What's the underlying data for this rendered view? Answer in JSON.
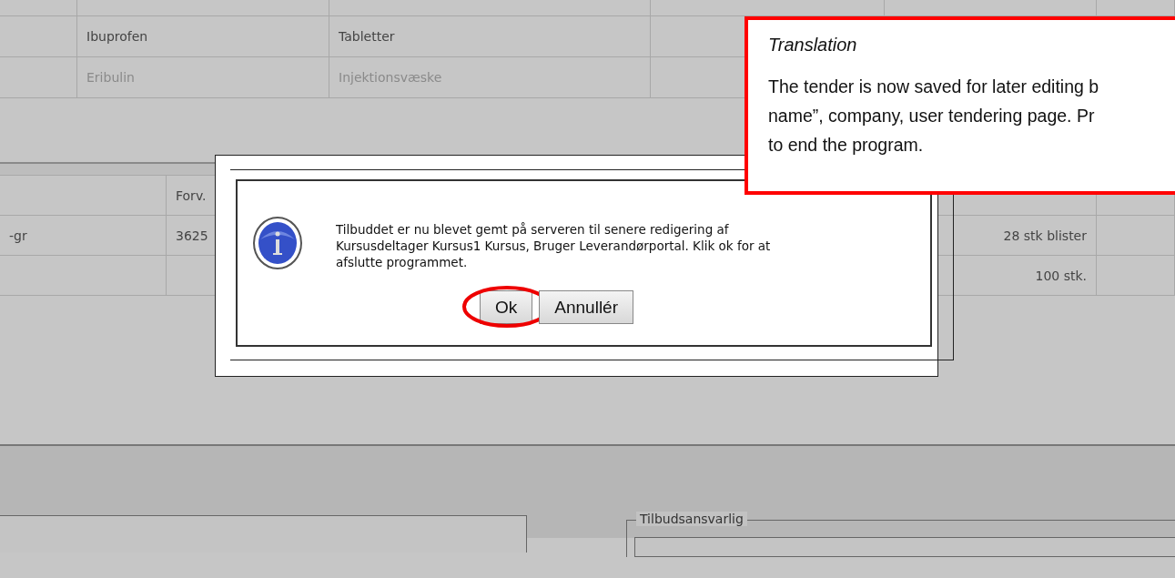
{
  "table_top": {
    "rows": [
      {
        "column_2": "Ibuprofen",
        "column_3": "Tabletter",
        "disabled": false
      },
      {
        "column_2": "Eribulin",
        "column_3": "Injektionsvæske",
        "disabled": true
      }
    ]
  },
  "table_bottom": {
    "header": {
      "column_2": "Forv."
    },
    "rows": [
      {
        "column_1": "-gr",
        "column_2": "3625",
        "column_3": "28 stk blister"
      },
      {
        "column_3": "100 stk."
      }
    ]
  },
  "fieldset": {
    "legend": "Tilbudsansvarlig"
  },
  "dialog": {
    "message_lines": [
      "Tilbuddet er nu blevet gemt på serveren til senere redigering af",
      "Kursusdeltager Kursus1 Kursus, Bruger Leverandørportal. Klik ok for at",
      "afslutte programmet."
    ],
    "buttons": [
      {
        "label": "Ok",
        "highlighted": true
      },
      {
        "label": "Annullér",
        "highlighted": false
      }
    ]
  },
  "translation_note": {
    "title": "Translation",
    "lines": [
      "The tender is now saved for later editing b",
      "name”, company, user tendering page. Pr",
      "to end the program."
    ]
  }
}
